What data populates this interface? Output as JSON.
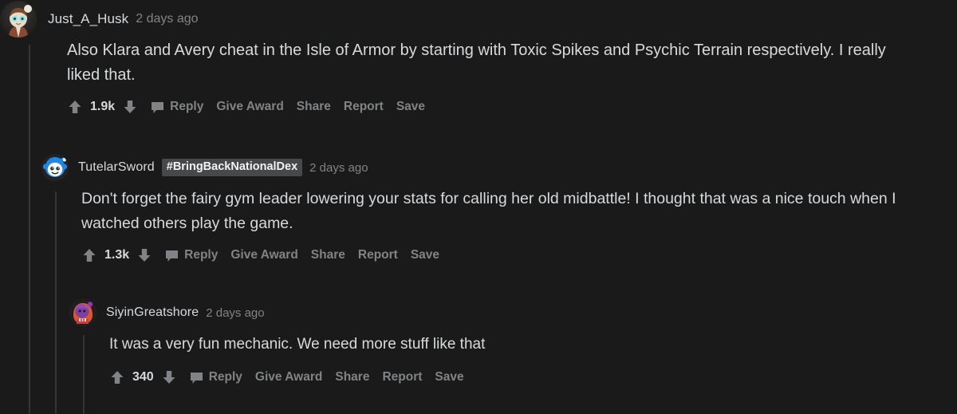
{
  "theme": {
    "background": "#1a1a1b",
    "text_primary": "#d7dadc",
    "text_muted": "#818384",
    "threadline": "#343536",
    "flair_background": "#47484a"
  },
  "action_labels": {
    "reply": "Reply",
    "give_award": "Give Award",
    "share": "Share",
    "report": "Report",
    "save": "Save",
    "upvote": "upvote-icon",
    "downvote": "downvote-icon",
    "comment": "comment-bubble-icon"
  },
  "comments": [
    {
      "id": "comment-1",
      "depth": 0,
      "username": "Just_A_Husk",
      "flair": null,
      "timestamp": "2 days ago",
      "body": "Also Klara and Avery cheat in the Isle of Armor by starting with Toxic Spikes and Psychic Terrain respectively. I really liked that.",
      "body_lines": [
        "Also Klara and Avery cheat in the Isle of Armor by starting with Toxic Spikes and Psychic Terrain",
        "respectively. I really liked that."
      ],
      "score": "1.9k",
      "avatar": "snoo-avatar-brown-jacket"
    },
    {
      "id": "comment-2",
      "depth": 1,
      "username": "TutelarSword",
      "flair": "#BringBackNationalDex",
      "timestamp": "2 days ago",
      "body": "Don't forget the fairy gym leader lowering your stats for calling her old midbattle! I thought that was a nice touch when I watched others play the game.",
      "body_lines": [
        "Don't forget the fairy gym leader lowering your stats for calling her old midbattle! I thought that",
        "was a nice touch when I watched others play the game."
      ],
      "score": "1.3k",
      "avatar": "snoo-avatar-blue-hair"
    },
    {
      "id": "comment-3",
      "depth": 2,
      "username": "SiyinGreatshore",
      "flair": null,
      "timestamp": "2 days ago",
      "body": "It was a very fun mechanic. We need more stuff like that",
      "body_lines": [
        "It was a very fun mechanic. We need more stuff like that"
      ],
      "score": "340",
      "avatar": "character-avatar-purple-orange"
    }
  ]
}
